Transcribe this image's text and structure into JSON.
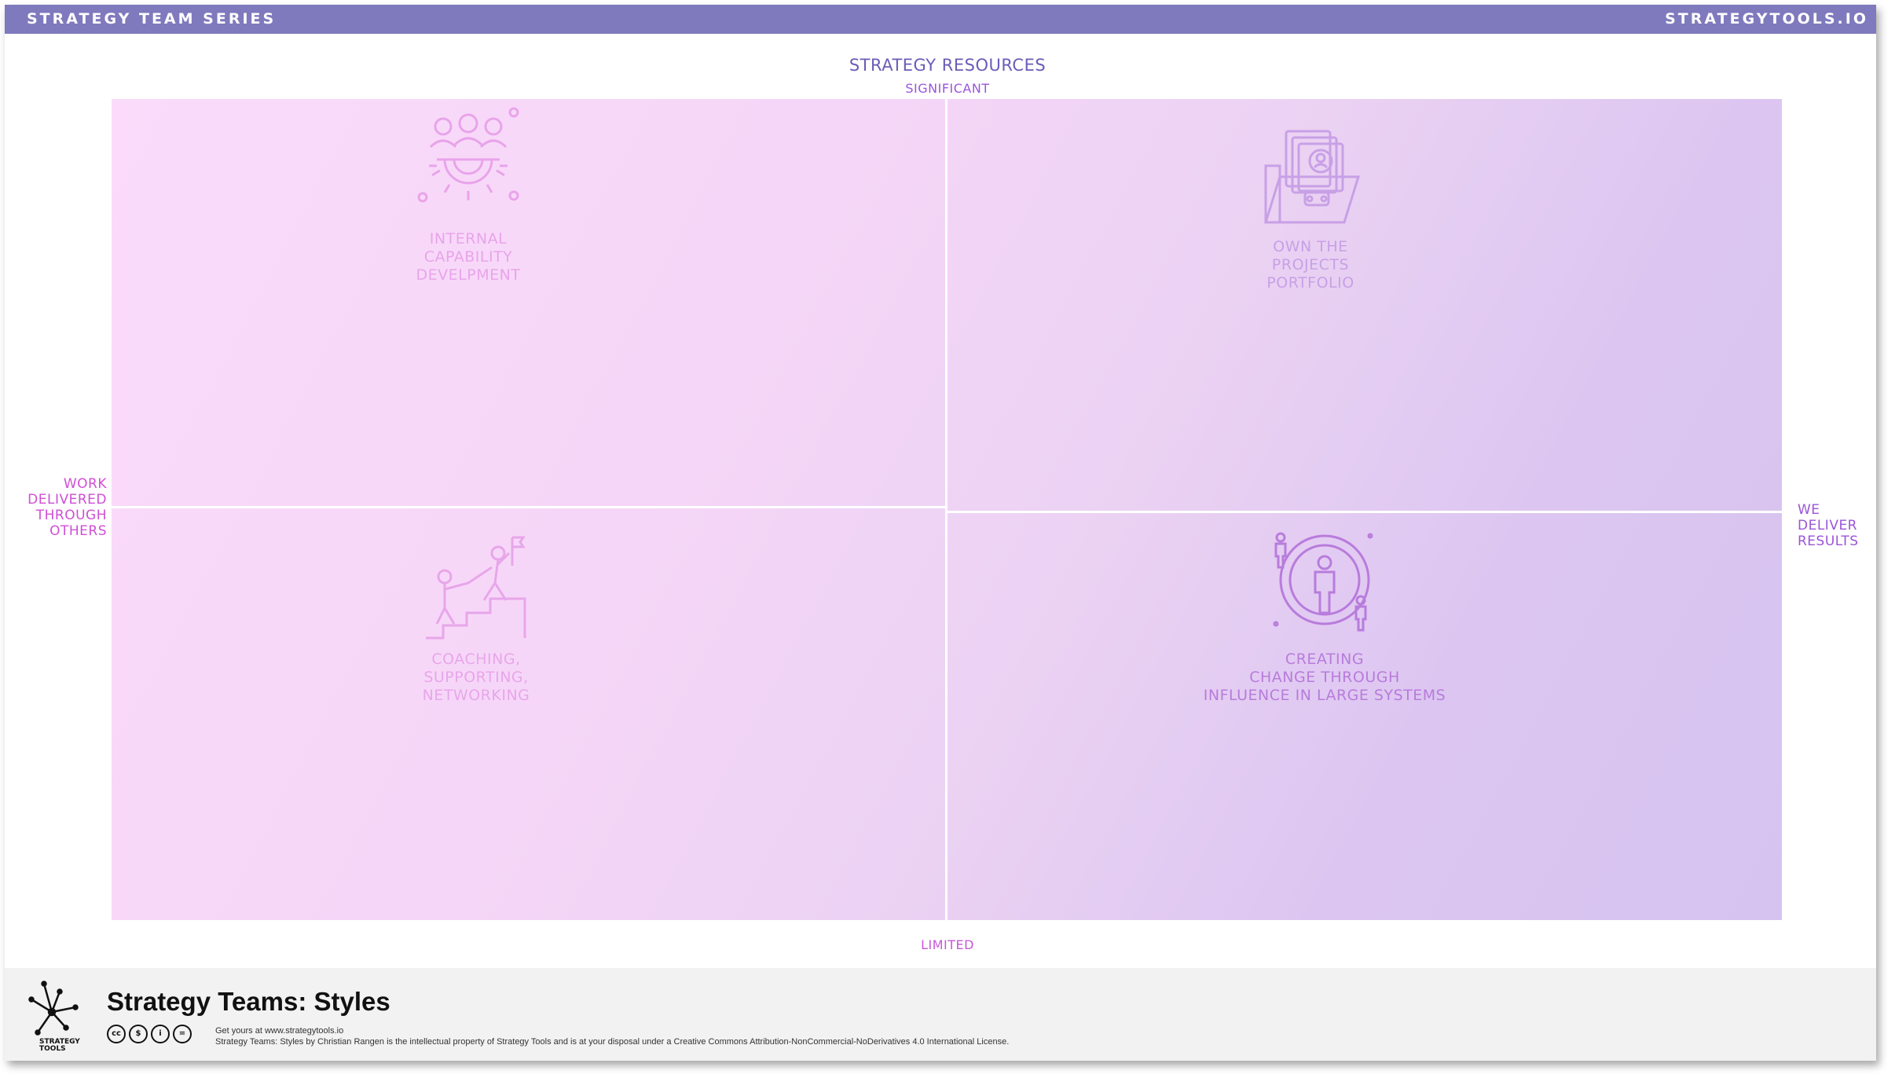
{
  "header": {
    "series_label": "STRATEGY TEAM SERIES",
    "site_label": "STRATEGYTOOLS.IO"
  },
  "axes": {
    "vertical_title": "STRATEGY RESOURCES",
    "top_label": "SIGNIFICANT",
    "bottom_label": "LIMITED",
    "left_label": "WORK\nDELIVERED\nTHROUGH\nOTHERS",
    "right_label": "WE\nDELIVER\nRESULTS"
  },
  "quadrants": {
    "top_left": {
      "label": "INTERNAL\nCAPABILITY\nDEVELPMENT",
      "icon": "team-gear-icon"
    },
    "top_right": {
      "label": "OWN THE\nPROJECTS\nPORTFOLIO",
      "icon": "folder-portfolio-icon"
    },
    "bottom_left": {
      "label": "COACHING,\nSUPPORTING,\nNETWORKING",
      "icon": "coaching-climb-icon"
    },
    "bottom_right": {
      "label": "CREATING\nCHANGE THROUGH\nINFLUENCE IN LARGE SYSTEMS",
      "icon": "influence-people-icon"
    }
  },
  "footer": {
    "title": "Strategy Teams: Styles",
    "logo_text": "STRATEGY\nTOOLS",
    "get_yours": "Get yours at www.strategytools.io",
    "license": "Strategy Teams: Styles by Christian Rangen is the intellectual property of Strategy Tools and is at your disposal under a Creative Commons Attribution-NonCommercial-NoDerivatives 4.0 International License.",
    "cc_icons": [
      "cc",
      "nc",
      "by",
      "nd"
    ]
  },
  "colors": {
    "top_bar": "#7f79bd",
    "axis_title": "#6a5cb8",
    "pink_label": "#d04ed6",
    "purple_label": "#9b55d8",
    "matrix_left": "#fadbfa",
    "matrix_right": "#d6c3f0"
  }
}
